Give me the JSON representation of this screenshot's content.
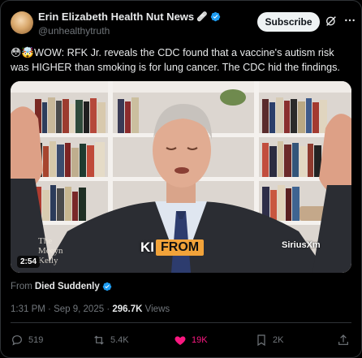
{
  "author": {
    "display_name": "Erin Elizabeth Health Nut News",
    "name_emoji": "🩹",
    "handle": "@unhealthytruth"
  },
  "header": {
    "subscribe_label": "Subscribe"
  },
  "tweet": {
    "text": "😳🤯WOW: RFK Jr. reveals the CDC found that a vaccine's autism risk was HIGHER than smoking is for lung cancer. The CDC hid the findings."
  },
  "video": {
    "duration": "2:54",
    "overlay_text_left": "KI",
    "overlay_text_badge": "FROM",
    "channel_logo": "SiriusXm",
    "book_watermark": "The Meeyn Kelly Show"
  },
  "source": {
    "prefix": "From",
    "name": "Died Suddenly"
  },
  "meta": {
    "time": "1:31 PM",
    "date": "Sep 9, 2025",
    "views_count": "296.7K",
    "views_label": "Views",
    "separator": "·"
  },
  "actions": {
    "replies": "519",
    "reposts": "5.4K",
    "likes": "19K",
    "bookmarks": "2K"
  },
  "colors": {
    "like": "#f91880",
    "verified": "#1d9bf0",
    "muted": "#71767b"
  }
}
